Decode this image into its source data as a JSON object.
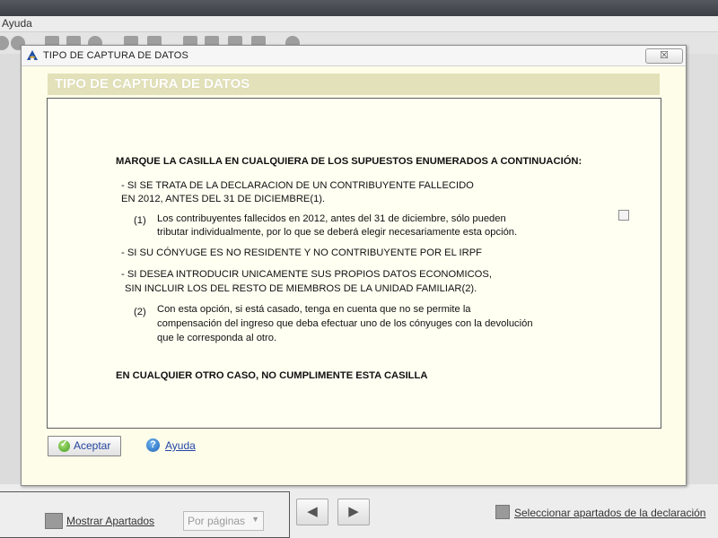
{
  "menu": {
    "item_ayuda": "Ayuda"
  },
  "dialog": {
    "title": "TIPO DE CAPTURA DE DATOS",
    "close_symbol": "☒",
    "header": "TIPO DE CAPTURA DE DATOS",
    "checkbox_label": "MARQUE LA CASILLA EN CUALQUIERA DE LOS SUPUESTOS ENUMERADOS A CONTINUACIÓN:",
    "checkbox_checked": false,
    "case1_line1": "- SI SE TRATA DE LA DECLARACION DE UN CONTRIBUYENTE FALLECIDO",
    "case1_line2": "EN 2012, ANTES DEL 31 DE DICIEMBRE(1).",
    "note1_num": "(1)",
    "note1_line1": "Los contribuyentes fallecidos en 2012, antes del 31 de diciembre, sólo pueden",
    "note1_line2": "tributar individualmente, por lo que se deberá elegir necesariamente esta opción.",
    "case2": "- SI SU CÓNYUGE ES NO RESIDENTE Y NO CONTRIBUYENTE POR EL IRPF",
    "case3_line1": "- SI DESEA INTRODUCIR UNICAMENTE SUS PROPIOS DATOS ECONOMICOS,",
    "case3_line2": "SIN INCLUIR LOS DEL RESTO DE MIEMBROS DE LA UNIDAD FAMILIAR(2).",
    "note2_num": "(2)",
    "note2_line1": "Con esta opción, si está casado, tenga en cuenta que no se permite la",
    "note2_line2": "compensación del ingreso que deba efectuar uno de los cónyuges con la devolución",
    "note2_line3": "que le corresponda al otro.",
    "footer_text": "EN CUALQUIER OTRO CASO, NO CUMPLIMENTE ESTA CASILLA",
    "accept_label": "Aceptar",
    "help_label": "Ayuda",
    "help_icon_glyph": "?",
    "accent_color": "#2345a8",
    "header_bg": "#e3e1b9"
  },
  "bottom": {
    "show_sections": "Mostrar Apartados",
    "page_select_value": "Por páginas",
    "prev_glyph": "◀",
    "next_glyph": "▶",
    "select_sections": "Seleccionar apartados de la declaración"
  }
}
